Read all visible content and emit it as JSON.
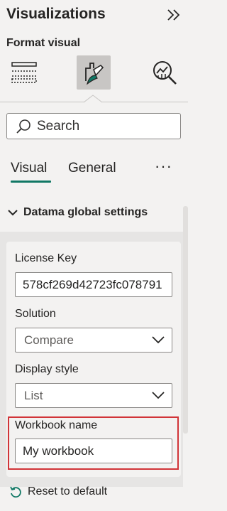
{
  "pane": {
    "title": "Visualizations",
    "subtitle": "Format visual",
    "collapse_icon": "double-chevron-right-icon"
  },
  "format_tabs": [
    {
      "id": "build",
      "icon": "build-visual-icon",
      "selected": false
    },
    {
      "id": "format",
      "icon": "format-paintbrush-icon",
      "selected": true
    },
    {
      "id": "analytics",
      "icon": "analytics-magnifier-icon",
      "selected": false
    }
  ],
  "search": {
    "placeholder": "Search",
    "value": ""
  },
  "pivot": {
    "tabs": [
      "Visual",
      "General"
    ],
    "active": "Visual",
    "more_label": "···"
  },
  "section": {
    "title": "Datama global settings",
    "expanded": true
  },
  "fields": {
    "license_key": {
      "label": "License Key",
      "value": "578cf269d42723fc078791"
    },
    "solution": {
      "label": "Solution",
      "value": "Compare"
    },
    "display_style": {
      "label": "Display style",
      "value": "List"
    },
    "workbook_name": {
      "label": "Workbook name",
      "value": "My workbook"
    }
  },
  "reset_label": "Reset to default",
  "colors": {
    "accent": "#117865",
    "highlight_border": "#d13438",
    "pane_background": "#f3f2f1"
  }
}
